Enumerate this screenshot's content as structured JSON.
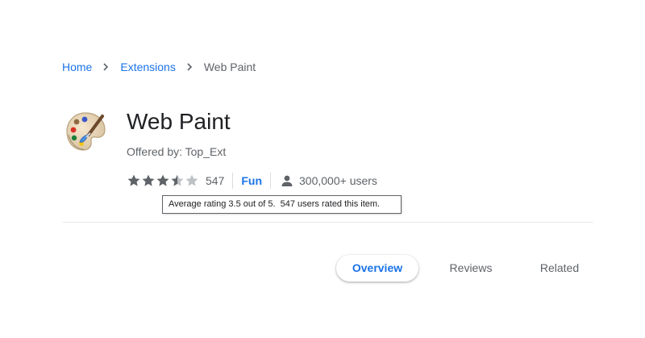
{
  "breadcrumb": {
    "home": "Home",
    "extensions": "Extensions",
    "current": "Web Paint"
  },
  "app": {
    "title": "Web Paint",
    "offered_by": "Offered by: Top_Ext",
    "rating": 3.5,
    "rating_count": "547",
    "category": "Fun",
    "users": "300,000+ users"
  },
  "tooltip": {
    "text": "Average rating 3.5 out of 5.  547 users rated this item."
  },
  "tabs": [
    {
      "label": "Overview",
      "active": true
    },
    {
      "label": "Reviews",
      "active": false
    },
    {
      "label": "Related",
      "active": false
    }
  ],
  "colors": {
    "link": "#1a73e8",
    "text": "#202124",
    "muted": "#5f6368",
    "star": "#5f6368",
    "star_empty": "#bdc1c6"
  },
  "icons": {
    "app": "paint-palette-icon",
    "separator": "chevron-right-icon",
    "users": "person-icon",
    "star": "star-icon"
  }
}
